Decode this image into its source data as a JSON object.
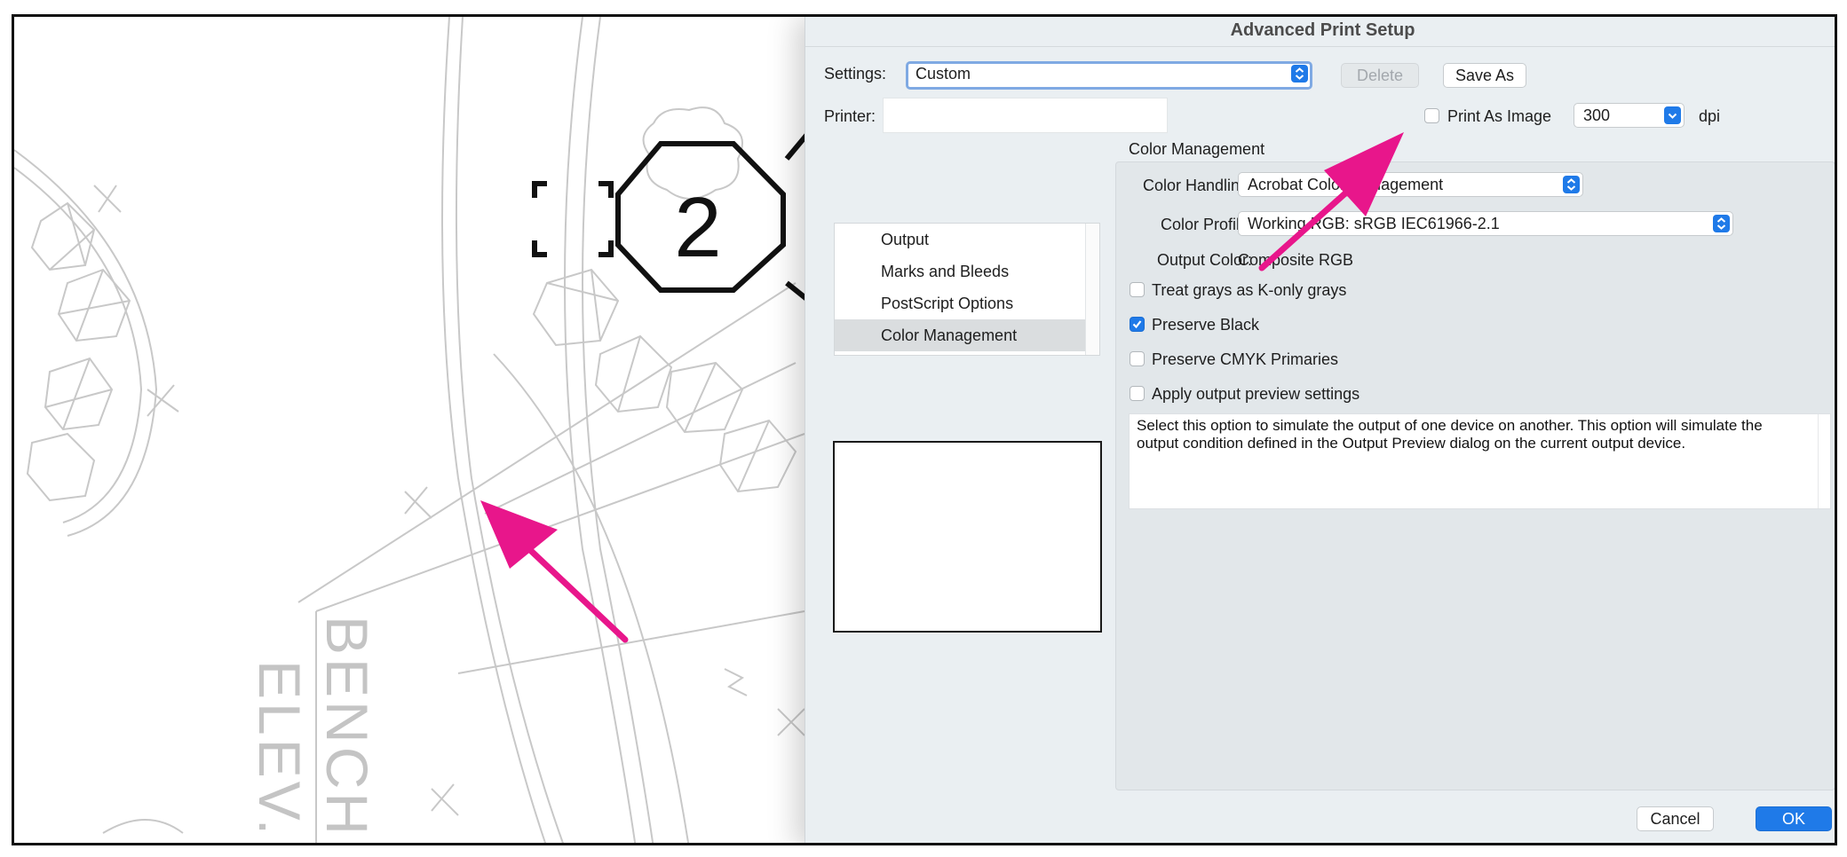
{
  "dialog": {
    "title": "Advanced Print Setup",
    "settings_label": "Settings:",
    "settings_value": "Custom",
    "delete_label": "Delete",
    "save_as_label": "Save As",
    "printer_label": "Printer:",
    "print_as_image_label": "Print As Image",
    "print_as_image_checked": false,
    "dpi_value": "300",
    "dpi_unit": "dpi",
    "categories": [
      {
        "label": "Output",
        "selected": false
      },
      {
        "label": "Marks and Bleeds",
        "selected": false
      },
      {
        "label": "PostScript Options",
        "selected": false
      },
      {
        "label": "Color Management",
        "selected": true
      }
    ],
    "section_title": "Color Management",
    "color_handling_label": "Color Handling:",
    "color_handling_value": "Acrobat Color Management",
    "color_profile_label": "Color Profile:",
    "color_profile_value": "Working RGB: sRGB IEC61966-2.1",
    "output_color_label": "Output Color:",
    "output_color_value": "Composite RGB",
    "options": [
      {
        "label": "Treat grays as K-only grays",
        "checked": false
      },
      {
        "label": "Preserve Black",
        "checked": true
      },
      {
        "label": "Preserve CMYK Primaries",
        "checked": false
      },
      {
        "label": "Apply output preview settings",
        "checked": false
      }
    ],
    "description": "Select this option to simulate the output of one device on another. This option will simulate the output condition defined in the Output Preview dialog on the current output device.",
    "cancel_label": "Cancel",
    "ok_label": "OK"
  },
  "drawing": {
    "tag_number": "2",
    "text_bench": "BENCH",
    "text_elev": "ELEV."
  },
  "colors": {
    "accent": "#1f7ae8",
    "annotation_arrow": "#e8168b",
    "linework": "#c8c8c8"
  },
  "icons": {
    "stepper": "up-down-chevron-icon",
    "dropdown": "chevron-down-icon",
    "checkmark": "checkmark-icon",
    "arrow": "annotation-arrow-icon"
  }
}
